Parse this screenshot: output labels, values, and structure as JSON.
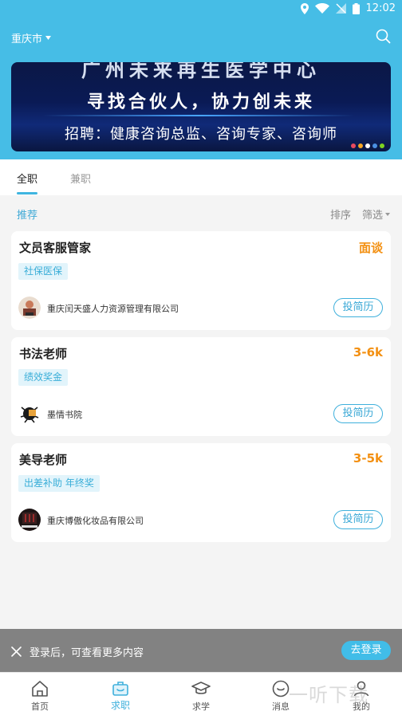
{
  "status_bar": {
    "time": "12:02"
  },
  "header": {
    "city": "重庆市"
  },
  "banner": {
    "line1": "广州未来再生医学中心",
    "line2": "寻找合伙人，协力创未来",
    "line3": "招聘：健康咨询总监、咨询专家、咨询师"
  },
  "tabs": [
    "全职",
    "兼职"
  ],
  "filter_row": {
    "recommend": "推荐",
    "sort": "排序",
    "filter": "筛选"
  },
  "jobs": [
    {
      "title": "文员客服管家",
      "salary": "面谈",
      "tag": "社保医保",
      "company": "重庆闰天盛人力资源管理有限公司",
      "apply": "投简历"
    },
    {
      "title": "书法老师",
      "salary": "3-6k",
      "tag": "绩效奖金",
      "company": "墨情书院",
      "apply": "投简历"
    },
    {
      "title": "美导老师",
      "salary": "3-5k",
      "tag": "出差补助 年终奖",
      "company": "重庆博傲化妆品有限公司",
      "apply": "投简历"
    }
  ],
  "login_bar": {
    "message": "登录后，可查看更多内容",
    "button": "去登录"
  },
  "bottom_nav": [
    "首页",
    "求职",
    "求学",
    "消息",
    "我的"
  ],
  "watermark": "一听下载",
  "colors": {
    "brand": "#46bde6",
    "salary": "#f39012",
    "tag_text": "#3aaed8"
  }
}
